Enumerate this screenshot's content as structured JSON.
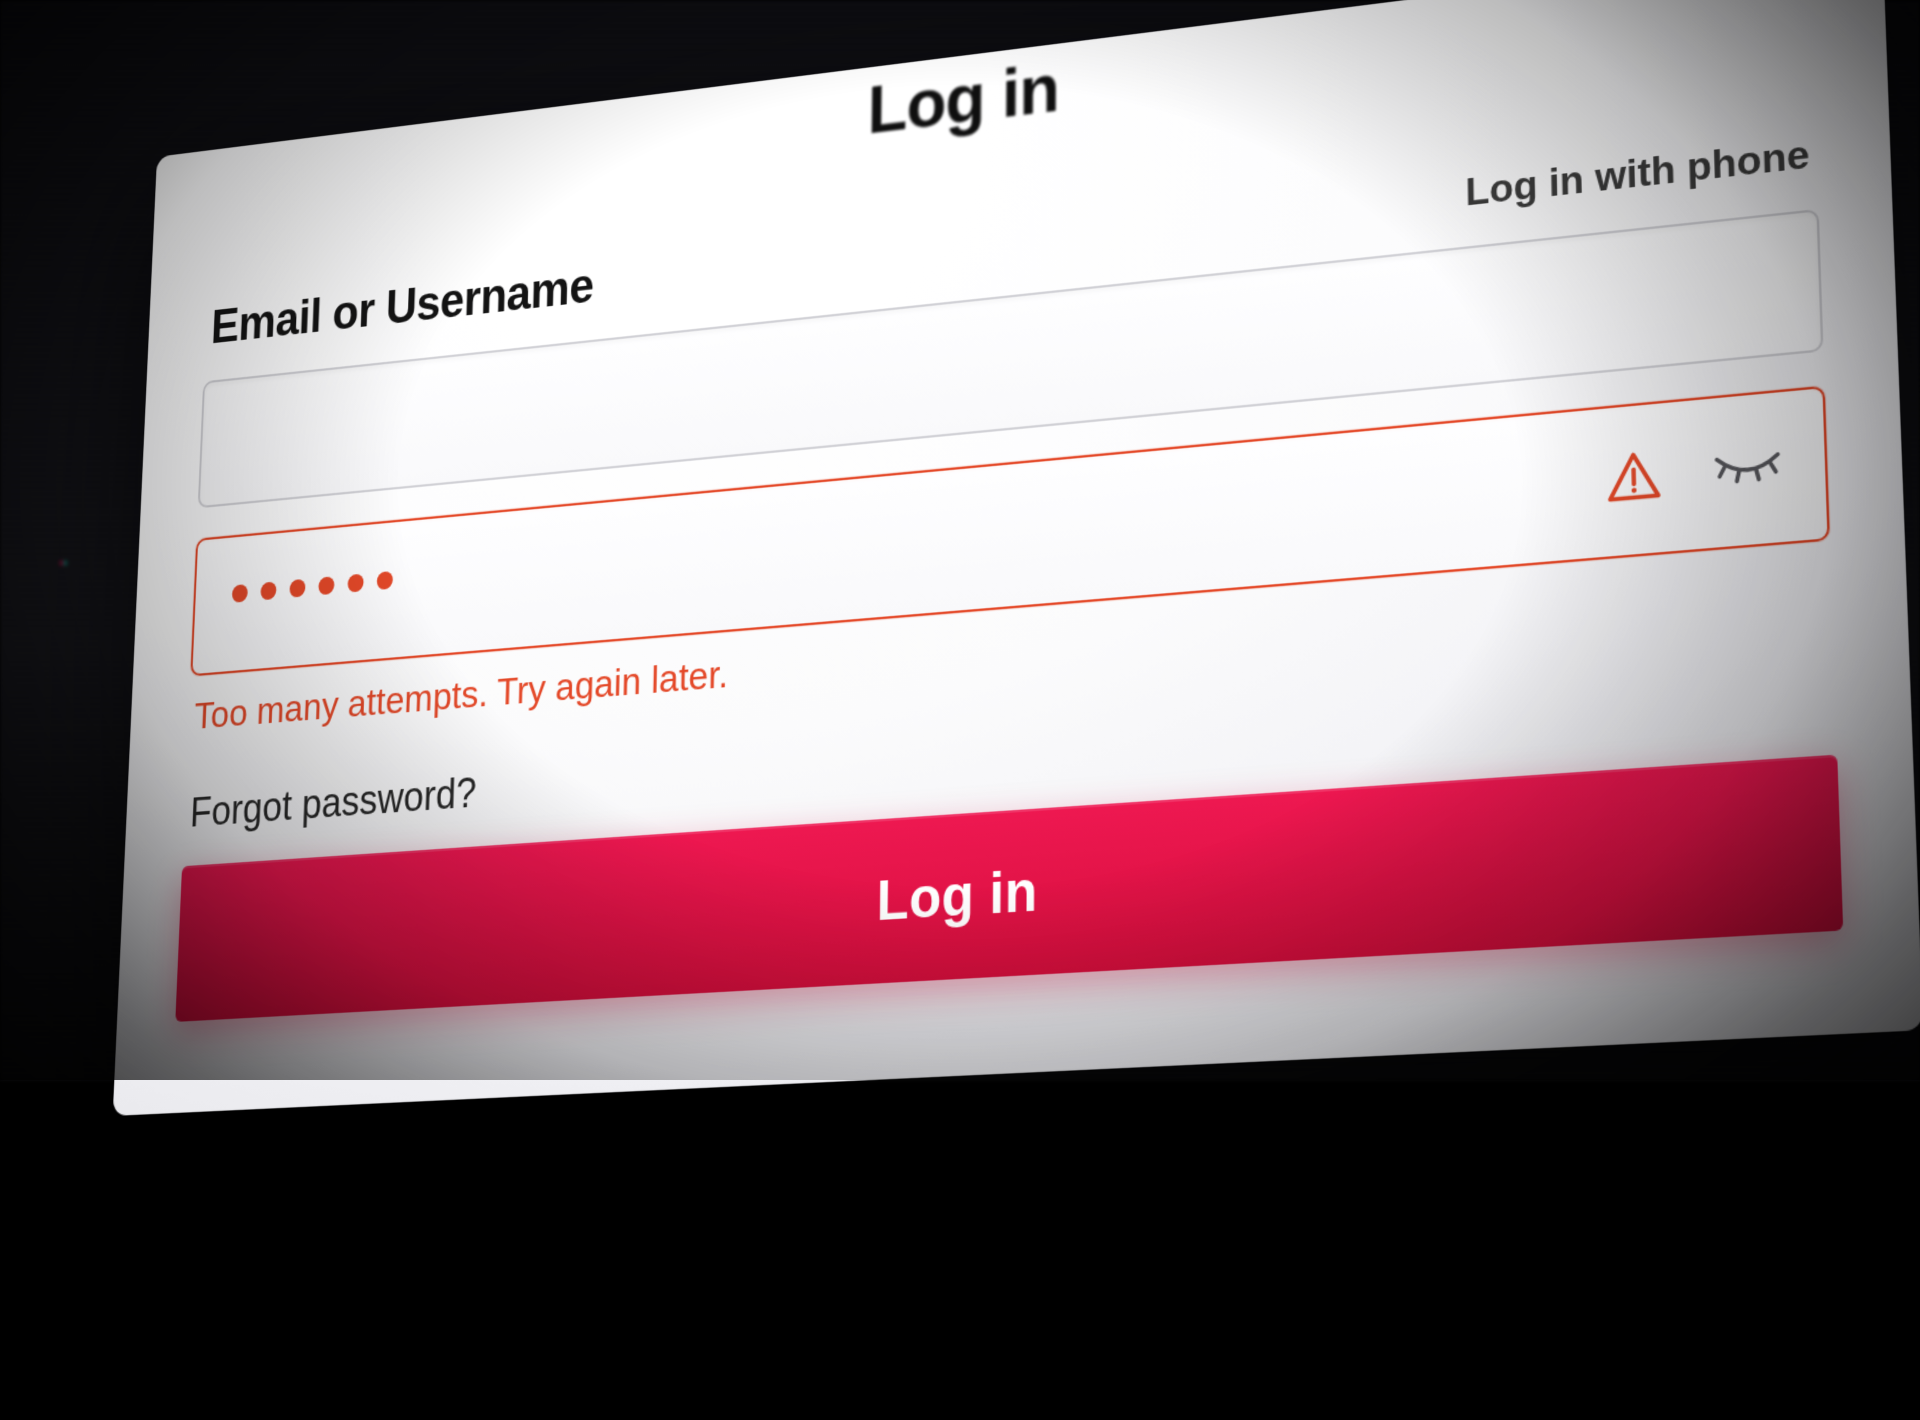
{
  "title": "Log in",
  "field_label": "Email or Username",
  "alt_login_label": "Log in with phone",
  "email_value": "",
  "password_masked": "••••••",
  "error_message": "Too many attempts. Try again later.",
  "forgot_label": "Forgot password?",
  "submit_label": "Log in",
  "colors": {
    "error": "#e24a2b",
    "primary": "#e0174a"
  },
  "icons": {
    "warning": "warning-triangle-icon",
    "hide_password": "eye-closed-icon"
  }
}
